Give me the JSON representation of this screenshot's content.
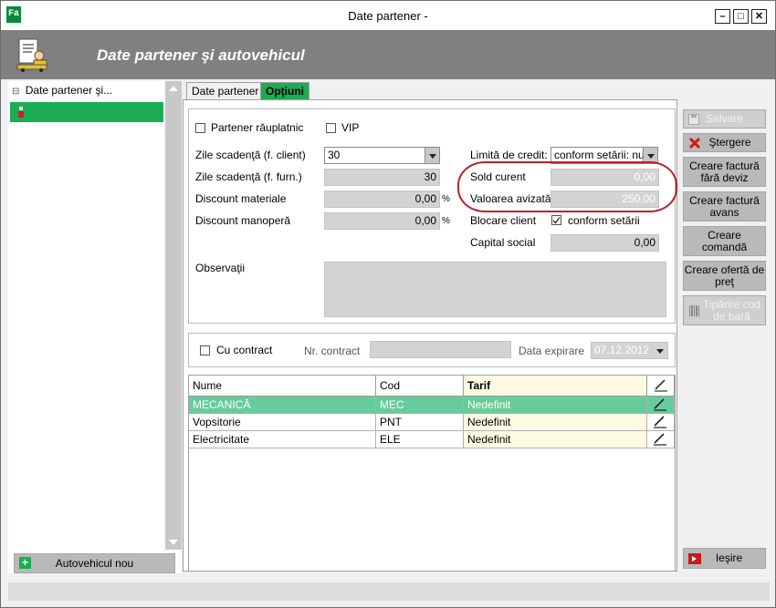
{
  "window": {
    "title": "Date partener -",
    "min_glyph": "–",
    "max_glyph": "□",
    "close_glyph": "✕",
    "logo_glyph": "Fa"
  },
  "header": {
    "title": "Date partener şi autovehicul"
  },
  "sidebar": {
    "tree_root": "Date partener şi...",
    "tree_expander": "⊟",
    "new_vehicle_label": "Autovehicul nou",
    "new_vehicle_glyph": "+"
  },
  "tabs": [
    {
      "label": "Date partener",
      "active": false
    },
    {
      "label": "Opţiuni",
      "active": true
    }
  ],
  "options": {
    "rau_platnic": {
      "label": "Partener răuplatnic",
      "checked": false
    },
    "vip": {
      "label": "VIP",
      "checked": false
    },
    "zile_scadenta_client": {
      "label": "Zile scadenţă (f. client)",
      "value": "30"
    },
    "zile_scadenta_furn": {
      "label": "Zile scadenţă (f. furn.)",
      "value": "30"
    },
    "discount_materiale": {
      "label": "Discount materiale",
      "value": "0,00",
      "unit": "%"
    },
    "discount_manopera": {
      "label": "Discount manoperă",
      "value": "0,00",
      "unit": "%"
    },
    "limita_credit": {
      "label": "Limită de credit:",
      "value": "conform setării: nu"
    },
    "sold_curent": {
      "label": "Sold curent",
      "value": "0,00"
    },
    "valoarea_avizata": {
      "label": "Valoarea avizată",
      "value": "250,00"
    },
    "blocare_client": {
      "label": "Blocare client",
      "check_label": "conform setării",
      "checked": true
    },
    "capital_social": {
      "label": "Capital social",
      "value": "0,00"
    },
    "observatii": {
      "label": "Observaţii",
      "value": ""
    }
  },
  "contract": {
    "cu_contract": {
      "label": "Cu contract",
      "checked": false
    },
    "nr_contract": {
      "label": "Nr. contract",
      "value": ""
    },
    "data_expirare": {
      "label": "Data expirare",
      "value": "07.12.2012"
    }
  },
  "grid": {
    "columns": [
      "Nume",
      "Cod",
      "Tarif"
    ],
    "rows": [
      {
        "nume": "MECANICĂ",
        "cod": "MEC",
        "tarif": "Nedefinit",
        "selected": true
      },
      {
        "nume": "Vopsitorie",
        "cod": "PNT",
        "tarif": "Nedefinit",
        "selected": false
      },
      {
        "nume": "Electricitate",
        "cod": "ELE",
        "tarif": "Nedefinit",
        "selected": false
      }
    ]
  },
  "actions": {
    "salvare": "Salvare",
    "stergere": "Ştergere",
    "factura_fara_deviz": "Creare factură fără deviz",
    "factura_avans": "Creare factură avans",
    "creare_comanda": "Creare comandă",
    "oferta_pret": "Creare ofertă de preţ",
    "tiparire_cod": "Tipărire cod de bară",
    "iesire": "Ieşire"
  },
  "colors": {
    "accent_green": "#1cac55",
    "selected_row": "#66cc99",
    "header_gray": "#808080",
    "highlight_red": "#c0202a",
    "tarif_column_bg": "#fffbe3"
  }
}
